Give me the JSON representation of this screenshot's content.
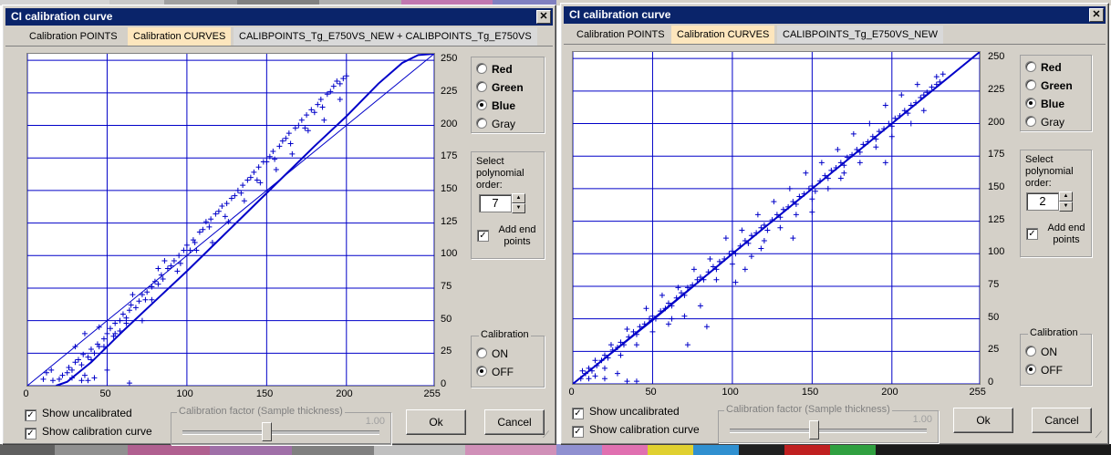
{
  "windows": [
    {
      "title": "CI calibration curve",
      "tabs": {
        "points": "Calibration POINTS",
        "curves": "Calibration CURVES",
        "file": "CALIBPOINTS_Tg_E750VS_NEW + CALIBPOINTS_Tg_E750VS"
      },
      "channels": [
        {
          "label": "Red",
          "selected": false,
          "bold": true
        },
        {
          "label": "Green",
          "selected": false,
          "bold": true
        },
        {
          "label": "Blue",
          "selected": true,
          "bold": true
        },
        {
          "label": "Gray",
          "selected": false,
          "bold": false
        }
      ],
      "poly": {
        "label": "Select polynomial order:",
        "value": "7",
        "add_end_points": "Add end points",
        "add_end_points_checked": true
      },
      "calibration": {
        "title": "Calibration",
        "on": "ON",
        "off": "OFF",
        "selected": "OFF"
      },
      "show_uncalibrated": {
        "label": "Show uncalibrated",
        "checked": true
      },
      "show_curve": {
        "label": "Show calibration curve",
        "checked": true
      },
      "factor": {
        "title": "Calibration factor (Sample thickness)",
        "value": "1.00",
        "position": 0.42
      },
      "ok": "Ok",
      "cancel": "Cancel",
      "close": "✕"
    },
    {
      "title": "CI calibration curve",
      "tabs": {
        "points": "Calibration POINTS",
        "curves": "Calibration CURVES",
        "file": "CALIBPOINTS_Tg_E750VS_NEW"
      },
      "channels": [
        {
          "label": "Red",
          "selected": false,
          "bold": true
        },
        {
          "label": "Green",
          "selected": false,
          "bold": true
        },
        {
          "label": "Blue",
          "selected": true,
          "bold": true
        },
        {
          "label": "Gray",
          "selected": false,
          "bold": false
        }
      ],
      "poly": {
        "label": "Select polynomial order:",
        "value": "2",
        "add_end_points": "Add end points",
        "add_end_points_checked": true
      },
      "calibration": {
        "title": "Calibration",
        "on": "ON",
        "off": "OFF",
        "selected": "OFF"
      },
      "show_uncalibrated": {
        "label": "Show uncalibrated",
        "checked": true
      },
      "show_curve": {
        "label": "Show calibration curve",
        "checked": true
      },
      "factor": {
        "title": "Calibration factor (Sample thickness)",
        "value": "1.00",
        "position": 0.42
      },
      "ok": "Ok",
      "cancel": "Cancel",
      "close": "✕"
    }
  ],
  "colors": {
    "plot": "#0000c8",
    "title_bar": "#0a246a",
    "tab_highlight": "#fde6bd"
  },
  "chart_data": [
    {
      "type": "scatter",
      "x_ticks": [
        "0",
        "50",
        "100",
        "150",
        "200",
        "255"
      ],
      "y_ticks": [
        "0",
        "25",
        "50",
        "75",
        "100",
        "125",
        "150",
        "175",
        "200",
        "225",
        "250"
      ],
      "xlim": [
        0,
        255
      ],
      "ylim": [
        0,
        255
      ],
      "grid": true,
      "identity_line": true,
      "curve": {
        "type": "polynomial",
        "order": 7,
        "x": [
          18,
          25,
          40,
          60,
          80,
          100,
          120,
          140,
          160,
          180,
          200,
          220,
          235,
          245,
          255
        ],
        "y": [
          0,
          3,
          18,
          42,
          65,
          88,
          112,
          136,
          160,
          184,
          207,
          232,
          248,
          254,
          255
        ]
      },
      "points": [
        [
          20,
          5
        ],
        [
          22,
          8
        ],
        [
          25,
          10
        ],
        [
          26,
          14
        ],
        [
          28,
          12
        ],
        [
          30,
          18
        ],
        [
          32,
          20
        ],
        [
          34,
          16
        ],
        [
          35,
          24
        ],
        [
          38,
          22
        ],
        [
          40,
          28
        ],
        [
          42,
          25
        ],
        [
          44,
          32
        ],
        [
          45,
          30
        ],
        [
          48,
          36
        ],
        [
          50,
          40
        ],
        [
          52,
          44
        ],
        [
          54,
          38
        ],
        [
          55,
          48
        ],
        [
          58,
          50
        ],
        [
          60,
          55
        ],
        [
          62,
          52
        ],
        [
          64,
          58
        ],
        [
          65,
          62
        ],
        [
          68,
          60
        ],
        [
          70,
          65
        ],
        [
          72,
          70
        ],
        [
          74,
          66
        ],
        [
          75,
          72
        ],
        [
          78,
          76
        ],
        [
          80,
          80
        ],
        [
          82,
          78
        ],
        [
          84,
          85
        ],
        [
          85,
          82
        ],
        [
          88,
          90
        ],
        [
          90,
          92
        ],
        [
          92,
          96
        ],
        [
          94,
          88
        ],
        [
          95,
          100
        ],
        [
          98,
          104
        ],
        [
          100,
          108
        ],
        [
          102,
          104
        ],
        [
          104,
          112
        ],
        [
          105,
          110
        ],
        [
          108,
          118
        ],
        [
          110,
          120
        ],
        [
          112,
          126
        ],
        [
          114,
          122
        ],
        [
          115,
          128
        ],
        [
          118,
          132
        ],
        [
          120,
          134
        ],
        [
          122,
          138
        ],
        [
          124,
          130
        ],
        [
          125,
          140
        ],
        [
          128,
          144
        ],
        [
          130,
          146
        ],
        [
          132,
          150
        ],
        [
          134,
          148
        ],
        [
          135,
          154
        ],
        [
          138,
          158
        ],
        [
          140,
          160
        ],
        [
          142,
          164
        ],
        [
          144,
          158
        ],
        [
          145,
          168
        ],
        [
          148,
          172
        ],
        [
          150,
          172
        ],
        [
          152,
          176
        ],
        [
          154,
          180
        ],
        [
          155,
          174
        ],
        [
          158,
          184
        ],
        [
          160,
          188
        ],
        [
          162,
          190
        ],
        [
          164,
          194
        ],
        [
          165,
          186
        ],
        [
          168,
          198
        ],
        [
          170,
          200
        ],
        [
          172,
          204
        ],
        [
          174,
          198
        ],
        [
          175,
          208
        ],
        [
          178,
          212
        ],
        [
          180,
          210
        ],
        [
          182,
          216
        ],
        [
          184,
          220
        ],
        [
          185,
          214
        ],
        [
          188,
          224
        ],
        [
          190,
          226
        ],
        [
          192,
          230
        ],
        [
          194,
          234
        ],
        [
          196,
          232
        ],
        [
          198,
          236
        ],
        [
          200,
          238
        ],
        [
          10,
          5
        ],
        [
          12,
          10
        ],
        [
          15,
          12
        ],
        [
          30,
          30
        ],
        [
          36,
          40
        ],
        [
          40,
          20
        ],
        [
          45,
          45
        ],
        [
          48,
          30
        ],
        [
          50,
          12
        ],
        [
          55,
          40
        ],
        [
          58,
          42
        ],
        [
          62,
          48
        ],
        [
          66,
          70
        ],
        [
          72,
          50
        ],
        [
          78,
          66
        ],
        [
          82,
          90
        ],
        [
          86,
          96
        ],
        [
          96,
          94
        ],
        [
          106,
          104
        ],
        [
          116,
          110
        ],
        [
          126,
          126
        ],
        [
          136,
          142
        ],
        [
          146,
          156
        ],
        [
          156,
          166
        ],
        [
          166,
          178
        ],
        [
          176,
          196
        ],
        [
          186,
          204
        ],
        [
          196,
          220
        ],
        [
          28,
          6
        ],
        [
          36,
          8
        ],
        [
          42,
          6
        ],
        [
          64,
          2
        ],
        [
          16,
          4
        ],
        [
          34,
          4
        ],
        [
          38,
          4
        ]
      ]
    },
    {
      "type": "scatter",
      "x_ticks": [
        "0",
        "50",
        "100",
        "150",
        "200",
        "255"
      ],
      "y_ticks": [
        "0",
        "25",
        "50",
        "75",
        "100",
        "125",
        "150",
        "175",
        "200",
        "225",
        "250"
      ],
      "xlim": [
        0,
        255
      ],
      "ylim": [
        0,
        255
      ],
      "grid": true,
      "identity_line": true,
      "curve": {
        "type": "polynomial",
        "order": 2,
        "x": [
          0,
          50,
          100,
          150,
          200,
          255
        ],
        "y": [
          0,
          49,
          100,
          150,
          200,
          255
        ]
      },
      "points": [
        [
          5,
          4
        ],
        [
          8,
          8
        ],
        [
          10,
          12
        ],
        [
          12,
          10
        ],
        [
          15,
          14
        ],
        [
          18,
          18
        ],
        [
          20,
          22
        ],
        [
          22,
          20
        ],
        [
          25,
          26
        ],
        [
          28,
          28
        ],
        [
          30,
          32
        ],
        [
          32,
          30
        ],
        [
          35,
          36
        ],
        [
          38,
          40
        ],
        [
          40,
          38
        ],
        [
          42,
          44
        ],
        [
          45,
          46
        ],
        [
          48,
          50
        ],
        [
          50,
          52
        ],
        [
          52,
          50
        ],
        [
          55,
          56
        ],
        [
          58,
          58
        ],
        [
          60,
          62
        ],
        [
          62,
          60
        ],
        [
          65,
          66
        ],
        [
          68,
          70
        ],
        [
          70,
          68
        ],
        [
          72,
          74
        ],
        [
          75,
          76
        ],
        [
          78,
          80
        ],
        [
          80,
          82
        ],
        [
          82,
          80
        ],
        [
          85,
          86
        ],
        [
          88,
          90
        ],
        [
          90,
          88
        ],
        [
          92,
          94
        ],
        [
          95,
          96
        ],
        [
          98,
          100
        ],
        [
          100,
          102
        ],
        [
          102,
          100
        ],
        [
          105,
          106
        ],
        [
          108,
          110
        ],
        [
          110,
          108
        ],
        [
          112,
          114
        ],
        [
          115,
          116
        ],
        [
          118,
          120
        ],
        [
          120,
          122
        ],
        [
          122,
          118
        ],
        [
          125,
          126
        ],
        [
          128,
          130
        ],
        [
          130,
          128
        ],
        [
          132,
          134
        ],
        [
          135,
          136
        ],
        [
          138,
          140
        ],
        [
          140,
          138
        ],
        [
          142,
          144
        ],
        [
          145,
          146
        ],
        [
          148,
          150
        ],
        [
          150,
          152
        ],
        [
          152,
          148
        ],
        [
          155,
          156
        ],
        [
          158,
          160
        ],
        [
          160,
          158
        ],
        [
          162,
          164
        ],
        [
          165,
          166
        ],
        [
          168,
          170
        ],
        [
          170,
          168
        ],
        [
          172,
          174
        ],
        [
          175,
          176
        ],
        [
          178,
          180
        ],
        [
          180,
          178
        ],
        [
          182,
          184
        ],
        [
          185,
          186
        ],
        [
          188,
          190
        ],
        [
          190,
          188
        ],
        [
          192,
          194
        ],
        [
          195,
          196
        ],
        [
          198,
          200
        ],
        [
          200,
          198
        ],
        [
          202,
          204
        ],
        [
          205,
          206
        ],
        [
          208,
          210
        ],
        [
          210,
          208
        ],
        [
          212,
          214
        ],
        [
          215,
          216
        ],
        [
          218,
          220
        ],
        [
          220,
          222
        ],
        [
          222,
          224
        ],
        [
          225,
          228
        ],
        [
          228,
          230
        ],
        [
          230,
          232
        ],
        [
          10,
          4
        ],
        [
          14,
          18
        ],
        [
          20,
          12
        ],
        [
          24,
          30
        ],
        [
          30,
          22
        ],
        [
          34,
          42
        ],
        [
          40,
          30
        ],
        [
          46,
          58
        ],
        [
          50,
          40
        ],
        [
          56,
          68
        ],
        [
          60,
          46
        ],
        [
          66,
          74
        ],
        [
          70,
          52
        ],
        [
          76,
          88
        ],
        [
          80,
          60
        ],
        [
          86,
          96
        ],
        [
          90,
          80
        ],
        [
          96,
          112
        ],
        [
          100,
          92
        ],
        [
          106,
          118
        ],
        [
          112,
          98
        ],
        [
          116,
          130
        ],
        [
          120,
          110
        ],
        [
          126,
          140
        ],
        [
          130,
          120
        ],
        [
          136,
          150
        ],
        [
          140,
          130
        ],
        [
          146,
          162
        ],
        [
          150,
          142
        ],
        [
          156,
          170
        ],
        [
          160,
          150
        ],
        [
          166,
          180
        ],
        [
          170,
          162
        ],
        [
          176,
          192
        ],
        [
          180,
          170
        ],
        [
          186,
          200
        ],
        [
          190,
          182
        ],
        [
          196,
          214
        ],
        [
          200,
          190
        ],
        [
          206,
          222
        ],
        [
          212,
          200
        ],
        [
          216,
          230
        ],
        [
          220,
          210
        ],
        [
          228,
          236
        ],
        [
          232,
          238
        ],
        [
          14,
          6
        ],
        [
          20,
          4
        ],
        [
          28,
          8
        ],
        [
          40,
          2
        ],
        [
          62,
          50
        ],
        [
          72,
          30
        ],
        [
          84,
          44
        ],
        [
          102,
          78
        ],
        [
          108,
          88
        ],
        [
          118,
          104
        ],
        [
          138,
          112
        ],
        [
          150,
          132
        ],
        [
          168,
          158
        ],
        [
          196,
          170
        ],
        [
          6,
          10
        ],
        [
          34,
          2
        ]
      ]
    }
  ]
}
